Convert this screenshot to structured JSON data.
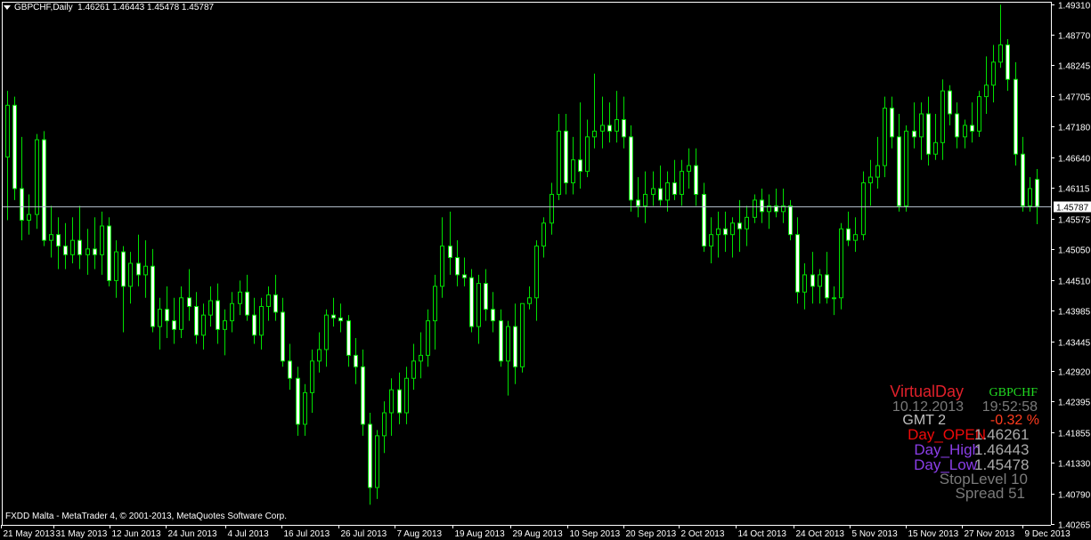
{
  "header": {
    "symbol_tf": "GBPCHF,Daily",
    "ohlc": "1.46261 1.46443 1.45478 1.45787"
  },
  "copyright": "FXDD Malta - MetaTrader 4, © 2001-2013, MetaQuotes Software Corp.",
  "colors": {
    "background": "#000000",
    "candle": "#00e000",
    "bull_body": "#000000",
    "bear_body": "#ffffff",
    "price_line": "#b0bcc8",
    "axis": "#ffffff"
  },
  "info_panel": {
    "virtual_day": "VirtualDay",
    "symbol": "GBPCHF",
    "date": "10.12.2013",
    "time": "19:52:58",
    "gmt": "GMT 2",
    "change": "-0.32 %",
    "day_open_label": "Day_OPEN",
    "day_open": "1.46261",
    "day_high_label": "Day_High",
    "day_high": "1.46443",
    "day_low_label": "Day_Low",
    "day_low": "1.45478",
    "stoplevel": "StopLevel 10",
    "spread": "Spread  51"
  },
  "chart_data": {
    "type": "candlestick",
    "symbol": "GBPCHF",
    "timeframe": "Daily",
    "ylim": [
      1.4025,
      1.4935
    ],
    "y_ticks": [
      "1.49310",
      "1.48770",
      "1.48245",
      "1.47705",
      "1.47180",
      "1.46640",
      "1.46115",
      "1.45575",
      "1.45050",
      "1.44510",
      "1.43985",
      "1.43445",
      "1.42920",
      "1.42395",
      "1.41855",
      "1.41330",
      "1.40790",
      "1.40265"
    ],
    "current_price": "1.45787",
    "x_ticks": [
      "21 May 2013",
      "31 May 2013",
      "12 Jun 2013",
      "24 Jun 2013",
      "4 Jul 2013",
      "16 Jul 2013",
      "26 Jul 2013",
      "7 Aug 2013",
      "19 Aug 2013",
      "29 Aug 2013",
      "10 Sep 2013",
      "20 Sep 2013",
      "2 Oct 2013",
      "14 Oct 2013",
      "24 Oct 2013",
      "5 Nov 2013",
      "15 Nov 2013",
      "27 Nov 2013",
      "9 Dec 2013"
    ],
    "ohlc": [
      [
        1.4665,
        1.478,
        1.4555,
        1.4755
      ],
      [
        1.4755,
        1.477,
        1.459,
        1.461
      ],
      [
        1.461,
        1.47,
        1.452,
        1.4555
      ],
      [
        1.4555,
        1.46,
        1.453,
        1.4565
      ],
      [
        1.4565,
        1.4705,
        1.454,
        1.4695
      ],
      [
        1.4695,
        1.471,
        1.451,
        1.452
      ],
      [
        1.452,
        1.458,
        1.449,
        1.453
      ],
      [
        1.453,
        1.456,
        1.447,
        1.451
      ],
      [
        1.451,
        1.455,
        1.447,
        1.4495
      ],
      [
        1.4495,
        1.456,
        1.448,
        1.452
      ],
      [
        1.452,
        1.458,
        1.447,
        1.4495
      ],
      [
        1.4495,
        1.454,
        1.446,
        1.4505
      ],
      [
        1.4505,
        1.456,
        1.447,
        1.4495
      ],
      [
        1.4495,
        1.457,
        1.446,
        1.4545
      ],
      [
        1.4545,
        1.456,
        1.444,
        1.445
      ],
      [
        1.445,
        1.452,
        1.442,
        1.45
      ],
      [
        1.45,
        1.451,
        1.436,
        1.444
      ],
      [
        1.444,
        1.45,
        1.441,
        1.448
      ],
      [
        1.448,
        1.453,
        1.444,
        1.446
      ],
      [
        1.446,
        1.452,
        1.442,
        1.4475
      ],
      [
        1.4475,
        1.4505,
        1.436,
        1.437
      ],
      [
        1.437,
        1.442,
        1.433,
        1.44
      ],
      [
        1.44,
        1.444,
        1.435,
        1.438
      ],
      [
        1.438,
        1.442,
        1.434,
        1.4365
      ],
      [
        1.4365,
        1.444,
        1.435,
        1.442
      ],
      [
        1.442,
        1.447,
        1.438,
        1.4405
      ],
      [
        1.4405,
        1.443,
        1.434,
        1.4355
      ],
      [
        1.4355,
        1.441,
        1.433,
        1.439
      ],
      [
        1.439,
        1.444,
        1.437,
        1.4415
      ],
      [
        1.4415,
        1.4445,
        1.434,
        1.4365
      ],
      [
        1.4365,
        1.44,
        1.432,
        1.438
      ],
      [
        1.438,
        1.443,
        1.436,
        1.441
      ],
      [
        1.441,
        1.445,
        1.439,
        1.443
      ],
      [
        1.443,
        1.446,
        1.438,
        1.439
      ],
      [
        1.439,
        1.442,
        1.434,
        1.4355
      ],
      [
        1.4355,
        1.442,
        1.433,
        1.4405
      ],
      [
        1.4405,
        1.444,
        1.438,
        1.4425
      ],
      [
        1.4425,
        1.446,
        1.438,
        1.4395
      ],
      [
        1.4395,
        1.442,
        1.43,
        1.431
      ],
      [
        1.431,
        1.434,
        1.426,
        1.428
      ],
      [
        1.428,
        1.43,
        1.418,
        1.42
      ],
      [
        1.42,
        1.427,
        1.418,
        1.4255
      ],
      [
        1.4255,
        1.433,
        1.422,
        1.431
      ],
      [
        1.431,
        1.436,
        1.429,
        1.433
      ],
      [
        1.433,
        1.44,
        1.43,
        1.439
      ],
      [
        1.439,
        1.442,
        1.437,
        1.4385
      ],
      [
        1.4385,
        1.441,
        1.436,
        1.438
      ],
      [
        1.438,
        1.439,
        1.43,
        1.432
      ],
      [
        1.432,
        1.435,
        1.427,
        1.43
      ],
      [
        1.43,
        1.433,
        1.418,
        1.42
      ],
      [
        1.42,
        1.422,
        1.406,
        1.409
      ],
      [
        1.409,
        1.419,
        1.407,
        1.418
      ],
      [
        1.418,
        1.424,
        1.415,
        1.422
      ],
      [
        1.422,
        1.428,
        1.418,
        1.426
      ],
      [
        1.426,
        1.429,
        1.42,
        1.422
      ],
      [
        1.422,
        1.43,
        1.42,
        1.428
      ],
      [
        1.428,
        1.434,
        1.426,
        1.431
      ],
      [
        1.431,
        1.436,
        1.428,
        1.432
      ],
      [
        1.432,
        1.44,
        1.43,
        1.438
      ],
      [
        1.438,
        1.446,
        1.433,
        1.444
      ],
      [
        1.444,
        1.456,
        1.442,
        1.451
      ],
      [
        1.451,
        1.457,
        1.446,
        1.449
      ],
      [
        1.449,
        1.452,
        1.444,
        1.446
      ],
      [
        1.446,
        1.449,
        1.444,
        1.4455
      ],
      [
        1.4455,
        1.447,
        1.436,
        1.437
      ],
      [
        1.437,
        1.446,
        1.434,
        1.4445
      ],
      [
        1.4445,
        1.447,
        1.438,
        1.44
      ],
      [
        1.44,
        1.443,
        1.436,
        1.438
      ],
      [
        1.438,
        1.44,
        1.43,
        1.431
      ],
      [
        1.431,
        1.438,
        1.425,
        1.437
      ],
      [
        1.437,
        1.441,
        1.427,
        1.43
      ],
      [
        1.43,
        1.441,
        1.429,
        1.441
      ],
      [
        1.441,
        1.444,
        1.44,
        1.442
      ],
      [
        1.442,
        1.452,
        1.438,
        1.451
      ],
      [
        1.451,
        1.456,
        1.449,
        1.455
      ],
      [
        1.455,
        1.462,
        1.453,
        1.46
      ],
      [
        1.46,
        1.474,
        1.459,
        1.471
      ],
      [
        1.471,
        1.474,
        1.46,
        1.462
      ],
      [
        1.462,
        1.47,
        1.46,
        1.466
      ],
      [
        1.466,
        1.476,
        1.461,
        1.464
      ],
      [
        1.464,
        1.473,
        1.463,
        1.47
      ],
      [
        1.47,
        1.481,
        1.468,
        1.471
      ],
      [
        1.471,
        1.477,
        1.468,
        1.472
      ],
      [
        1.472,
        1.476,
        1.469,
        1.471
      ],
      [
        1.471,
        1.478,
        1.469,
        1.473
      ],
      [
        1.473,
        1.477,
        1.468,
        1.47
      ],
      [
        1.47,
        1.472,
        1.457,
        1.459
      ],
      [
        1.459,
        1.463,
        1.456,
        1.458
      ],
      [
        1.458,
        1.464,
        1.455,
        1.46
      ],
      [
        1.46,
        1.464,
        1.458,
        1.461
      ],
      [
        1.461,
        1.465,
        1.458,
        1.459
      ],
      [
        1.459,
        1.464,
        1.457,
        1.462
      ],
      [
        1.462,
        1.466,
        1.459,
        1.46
      ],
      [
        1.46,
        1.466,
        1.458,
        1.464
      ],
      [
        1.464,
        1.468,
        1.461,
        1.465
      ],
      [
        1.465,
        1.468,
        1.458,
        1.46
      ],
      [
        1.46,
        1.462,
        1.45,
        1.451
      ],
      [
        1.451,
        1.456,
        1.448,
        1.453
      ],
      [
        1.453,
        1.457,
        1.449,
        1.454
      ],
      [
        1.454,
        1.457,
        1.45,
        1.453
      ],
      [
        1.453,
        1.456,
        1.449,
        1.455
      ],
      [
        1.455,
        1.459,
        1.45,
        1.454
      ],
      [
        1.454,
        1.458,
        1.451,
        1.456
      ],
      [
        1.456,
        1.46,
        1.455,
        1.459
      ],
      [
        1.459,
        1.461,
        1.455,
        1.457
      ],
      [
        1.457,
        1.46,
        1.454,
        1.458
      ],
      [
        1.458,
        1.461,
        1.456,
        1.457
      ],
      [
        1.457,
        1.461,
        1.455,
        1.458
      ],
      [
        1.458,
        1.459,
        1.452,
        1.453
      ],
      [
        1.453,
        1.456,
        1.441,
        1.443
      ],
      [
        1.443,
        1.448,
        1.44,
        1.446
      ],
      [
        1.446,
        1.45,
        1.441,
        1.444
      ],
      [
        1.444,
        1.447,
        1.441,
        1.446
      ],
      [
        1.446,
        1.45,
        1.441,
        1.442
      ],
      [
        1.442,
        1.444,
        1.439,
        1.442
      ],
      [
        1.442,
        1.455,
        1.44,
        1.454
      ],
      [
        1.454,
        1.457,
        1.451,
        1.452
      ],
      [
        1.452,
        1.456,
        1.45,
        1.453
      ],
      [
        1.453,
        1.464,
        1.452,
        1.462
      ],
      [
        1.462,
        1.466,
        1.458,
        1.463
      ],
      [
        1.463,
        1.47,
        1.461,
        1.465
      ],
      [
        1.465,
        1.477,
        1.463,
        1.475
      ],
      [
        1.475,
        1.477,
        1.468,
        1.47
      ],
      [
        1.47,
        1.474,
        1.457,
        1.458
      ],
      [
        1.458,
        1.472,
        1.457,
        1.471
      ],
      [
        1.471,
        1.476,
        1.468,
        1.47
      ],
      [
        1.47,
        1.476,
        1.466,
        1.474
      ],
      [
        1.474,
        1.477,
        1.465,
        1.467
      ],
      [
        1.467,
        1.474,
        1.466,
        1.469
      ],
      [
        1.469,
        1.48,
        1.466,
        1.478
      ],
      [
        1.478,
        1.479,
        1.472,
        1.474
      ],
      [
        1.474,
        1.476,
        1.468,
        1.47
      ],
      [
        1.47,
        1.473,
        1.468,
        1.472
      ],
      [
        1.472,
        1.476,
        1.469,
        1.471
      ],
      [
        1.471,
        1.478,
        1.47,
        1.477
      ],
      [
        1.477,
        1.484,
        1.474,
        1.479
      ],
      [
        1.479,
        1.486,
        1.476,
        1.483
      ],
      [
        1.483,
        1.493,
        1.482,
        1.486
      ],
      [
        1.486,
        1.487,
        1.478,
        1.48
      ],
      [
        1.48,
        1.483,
        1.465,
        1.467
      ],
      [
        1.467,
        1.47,
        1.457,
        1.458
      ],
      [
        1.458,
        1.463,
        1.457,
        1.461
      ],
      [
        1.4626,
        1.4644,
        1.4548,
        1.4579
      ]
    ]
  }
}
